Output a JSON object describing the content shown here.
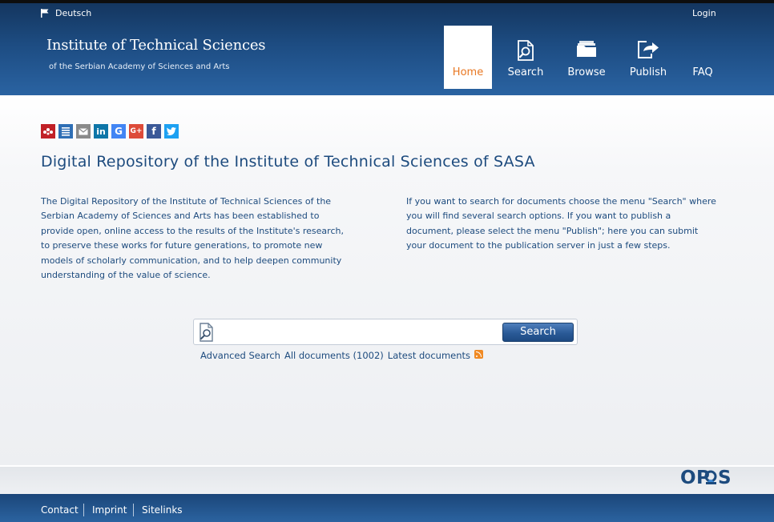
{
  "topbar": {
    "language": "Deutsch",
    "login": "Login"
  },
  "brand": {
    "title": "Institute of Technical Sciences",
    "subtitle": "of the Serbian Academy of Sciences and Arts"
  },
  "nav": {
    "home": "Home",
    "search": "Search",
    "browse": "Browse",
    "publish": "Publish",
    "faq": "FAQ",
    "active": "Home"
  },
  "share_icons": [
    {
      "name": "mendeley-icon",
      "color": "#c12127"
    },
    {
      "name": "list-icon",
      "color": "#2f6fb5"
    },
    {
      "name": "email-icon",
      "color": "#8a8a8a"
    },
    {
      "name": "linkedin-icon",
      "color": "#0e76a8"
    },
    {
      "name": "google-icon",
      "color": "#4285f4"
    },
    {
      "name": "google-plus-icon",
      "color": "#dd4b39"
    },
    {
      "name": "facebook-icon",
      "color": "#3b5998"
    },
    {
      "name": "twitter-icon",
      "color": "#1da1f2"
    }
  ],
  "main": {
    "title": "Digital Repository of the Institute of Technical Sciences of SASA",
    "left_text_lines": [
      "The Digital Repository of the Institute of Technical Sciences of the",
      "Serbian Academy of Sciences and Arts has been established to",
      "provide open, online access to the results of the Institute's research,",
      "to preserve these works for future generations, to promote new",
      "models of scholarly communication, and to help deepen community",
      "understanding of the value of science."
    ],
    "right_text_lines": [
      "If you want to search for documents choose the menu \"Search\" where",
      "you will find several search options. If you want to publish a",
      "document, please select the menu \"Publish\"; here you can submit",
      "your document to the publication server in just a few steps."
    ]
  },
  "search": {
    "input_value": "",
    "button_label": "Search",
    "advanced": "Advanced Search",
    "all_documents": "All documents (1002)",
    "latest": "Latest documents"
  },
  "logo_text": "OPUS",
  "footer": {
    "contact": "Contact",
    "imprint": "Imprint",
    "sitelinks": "Sitelinks"
  },
  "colors": {
    "header_blue": "#1d4c82",
    "text_blue": "#1d4b7e",
    "accent_orange": "#e87722"
  }
}
